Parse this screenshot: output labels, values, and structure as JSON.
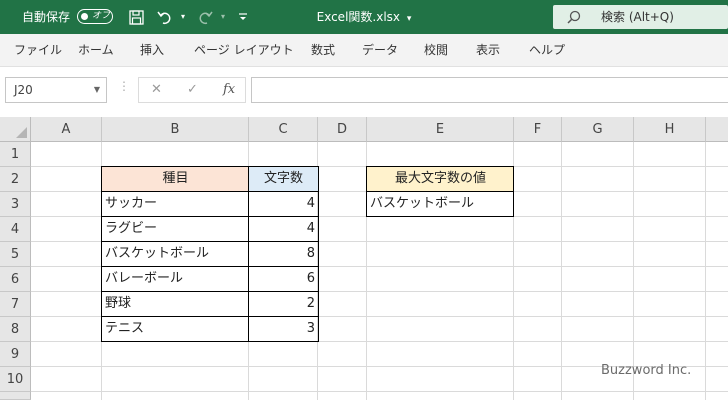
{
  "titlebar": {
    "autosave_label": "自動保存",
    "autosave_state": "オフ",
    "file_name": "Excel関数.xlsx",
    "file_dropdown": "▾",
    "search_placeholder": "検索 (Alt+Q)",
    "colors": {
      "bar": "#217346"
    }
  },
  "ribbon": {
    "tabs": [
      "ファイル",
      "ホーム",
      "挿入",
      "ページ レイアウト",
      "数式",
      "データ",
      "校閲",
      "表示",
      "ヘルプ"
    ]
  },
  "formula_bar": {
    "name_box": "J20",
    "formula": "",
    "cancel_icon": "✕",
    "enter_icon": "✓",
    "fx_label": "fx"
  },
  "sheet": {
    "columns": [
      "A",
      "B",
      "C",
      "D",
      "E",
      "F",
      "G",
      "H"
    ],
    "rows": [
      "1",
      "2",
      "3",
      "4",
      "5",
      "6",
      "7",
      "8",
      "9",
      "10"
    ],
    "table": {
      "headers": [
        "種目",
        "文字数"
      ],
      "rows": [
        [
          "サッカー",
          "4"
        ],
        [
          "ラグビー",
          "4"
        ],
        [
          "バスケットボール",
          "8"
        ],
        [
          "バレーボール",
          "6"
        ],
        [
          "野球",
          "2"
        ],
        [
          "テニス",
          "3"
        ]
      ]
    },
    "result": {
      "header": "最大文字数の値",
      "value": "バスケットボール"
    },
    "header_colors": {
      "orange": "#fce4d6",
      "blue": "#ddebf7",
      "yellow": "#fff2cc"
    }
  },
  "watermark": "Buzzword Inc."
}
